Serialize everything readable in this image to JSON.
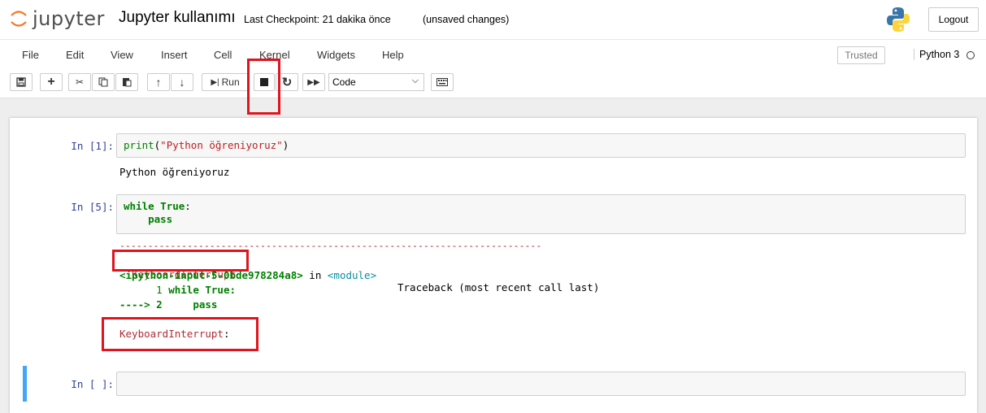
{
  "header": {
    "logo_text": "jupyter",
    "notebook_title": "Jupyter kullanımı",
    "checkpoint": "Last Checkpoint: 21 dakika önce",
    "unsaved": "(unsaved changes)",
    "logout_label": "Logout"
  },
  "menubar": {
    "items": [
      "File",
      "Edit",
      "View",
      "Insert",
      "Cell",
      "Kernel",
      "Widgets",
      "Help"
    ],
    "trusted_label": "Trusted",
    "kernel_label": "Python 3"
  },
  "toolbar": {
    "run_label": "Run",
    "cell_type": "Code"
  },
  "cells": [
    {
      "prompt": "In [1]:",
      "code_fn": "print",
      "code_open": "(",
      "code_str": "\"Python öğreniyoruz\"",
      "code_close": ")",
      "output": "Python öğreniyoruz"
    },
    {
      "prompt": "In [5]:",
      "line1_kw": "while",
      "line1_kw2": "True",
      "line1_rest": ":",
      "line2": "    pass",
      "tb_dashes": "---------------------------------------------------------------------------",
      "tb_name": "KeyboardInterrupt",
      "tb_header": "Traceback (most recent call last)",
      "tb_file": "<ipython-input-5-0bde978284a8>",
      "tb_in": " in ",
      "tb_module": "<module>",
      "tb_line1_num": "      1 ",
      "tb_line1_code": "while True:",
      "tb_arrow": "----> 2",
      "tb_line2_code": "     pass",
      "err_name": "KeyboardInterrupt",
      "err_colon": ":"
    },
    {
      "prompt": "In [ ]:"
    }
  ],
  "colors": {
    "highlight_box": "#e0141e",
    "selected_cell_bar": "#42a5f5",
    "prompt": "#303f9f"
  }
}
